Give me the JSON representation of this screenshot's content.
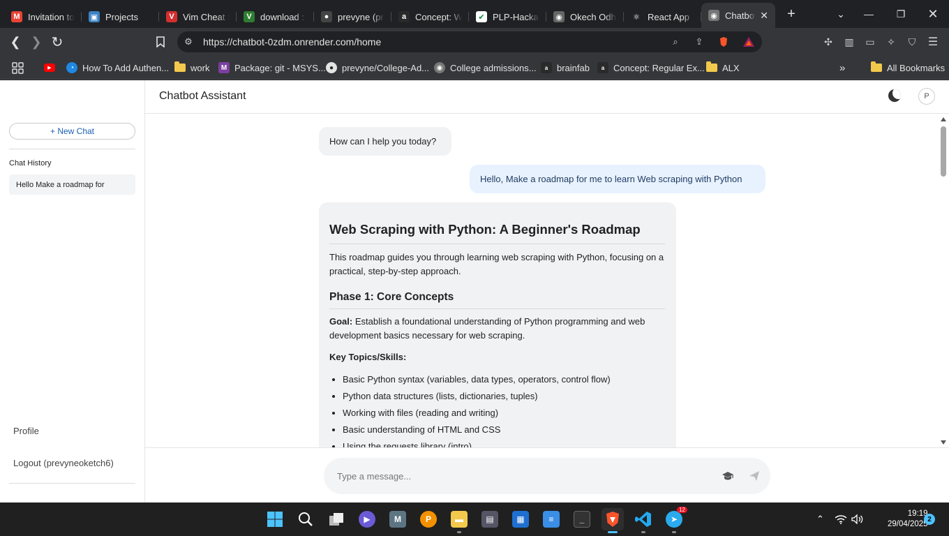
{
  "browser": {
    "tabs": [
      {
        "label": "Invitation to",
        "icon": "gmail-icon",
        "color": "#ea4335",
        "glyph": "M"
      },
      {
        "label": "Projects",
        "icon": "projects-icon",
        "color": "#3b82c4",
        "glyph": "▣"
      },
      {
        "label": "Vim Cheat S",
        "icon": "vim-icon",
        "color": "#d32f2f",
        "glyph": "V"
      },
      {
        "label": "download :",
        "icon": "vim-download-icon",
        "color": "#2e7d32",
        "glyph": "V"
      },
      {
        "label": "prevyne (pr",
        "icon": "github-icon",
        "color": "#444444",
        "glyph": "●"
      },
      {
        "label": "Concept: W",
        "icon": "alx-icon",
        "color": "#2a2a2a",
        "glyph": "a"
      },
      {
        "label": "PLP-Hackat",
        "icon": "form-icon",
        "color": "#ffffff",
        "glyph": "✔"
      },
      {
        "label": "Okech Odh",
        "icon": "globe-icon",
        "color": "#666666",
        "glyph": "◉"
      },
      {
        "label": "React App",
        "icon": "react-icon",
        "color": "#202124",
        "glyph": "⚛"
      },
      {
        "label": "Chatbo",
        "icon": "globe-icon",
        "color": "#777777",
        "glyph": "◉"
      }
    ],
    "url": "https://chatbot-0zdm.onrender.com/home",
    "bookmarks": [
      {
        "label": "",
        "icon": "youtube-icon"
      },
      {
        "label": "How To Add Authen...",
        "icon": "bookmark-site-icon"
      },
      {
        "label": "work",
        "icon": "folder-icon"
      },
      {
        "label": "Package: git - MSYS...",
        "icon": "msys-icon"
      },
      {
        "label": "prevyne/College-Ad...",
        "icon": "github-icon"
      },
      {
        "label": "College admissions...",
        "icon": "globe-icon"
      },
      {
        "label": "brainfab",
        "icon": "alx-icon"
      },
      {
        "label": "Concept: Regular Ex...",
        "icon": "alx-icon"
      },
      {
        "label": "ALX",
        "icon": "folder-icon"
      }
    ],
    "all_bookmarks": "All Bookmarks"
  },
  "app": {
    "title": "Chatbot Assistant",
    "avatar_initial": "P",
    "sidebar": {
      "new_chat": "+ New Chat",
      "history_title": "Chat History",
      "history": [
        "Hello Make a roadmap for"
      ],
      "profile": "Profile",
      "logout": "Logout (prevyneoketch6)"
    },
    "messages": {
      "greeting": "How can I help you today?",
      "user": "Hello, Make a roadmap for me to learn Web scraping with Python",
      "response": {
        "heading": "Web Scraping with Python: A Beginner's Roadmap",
        "intro": "This roadmap guides you through learning web scraping with Python, focusing on a practical, step-by-step approach.",
        "phase_title": "Phase 1: Core Concepts",
        "goal_label": "Goal:",
        "goal_text": " Establish a foundational understanding of Python programming and web development basics necessary for web scraping.",
        "topics_label": "Key Topics/Skills:",
        "topics": [
          "Basic Python syntax (variables, data types, operators, control flow)",
          "Python data structures (lists, dictionaries, tuples)",
          "Working with files (reading and writing)",
          "Basic understanding of HTML and CSS",
          "Using the requests library (intro)"
        ]
      }
    },
    "composer": {
      "placeholder": "Type a message..."
    }
  },
  "taskbar": {
    "time": "19:19",
    "date": "29/04/2025",
    "notification_count": "2",
    "telegram_badge": "12"
  }
}
